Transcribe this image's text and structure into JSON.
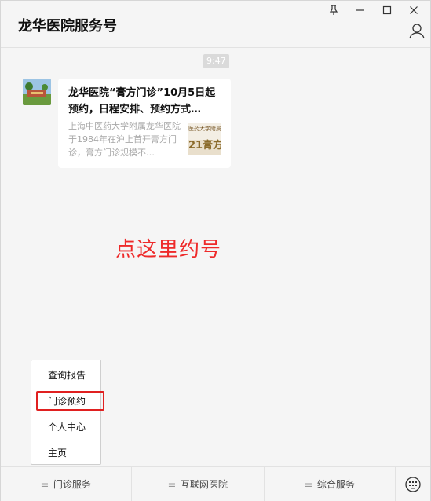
{
  "window": {
    "title": "龙华医院服务号"
  },
  "controls": {
    "pin_icon": "pin-icon",
    "minimize_icon": "minimize-icon",
    "maximize_icon": "maximize-icon",
    "close_icon": "close-icon",
    "user_icon": "user-icon"
  },
  "chat": {
    "timestamp": "9:47",
    "message": {
      "title": "龙华医院“膏方门诊”10月5日起预约，日程安排、预约方式…",
      "description": "上海中医药大学附属龙华医院于1984年在沪上首开膏方门诊，膏方门诊规模不…",
      "thumb_text_top": "医药大学附属",
      "thumb_text_bottom": "21膏方"
    },
    "annotation": "点这里约号"
  },
  "menu": {
    "items": [
      {
        "label": "查询报告"
      },
      {
        "label": "门诊预约"
      },
      {
        "label": "个人中心"
      },
      {
        "label": "主页"
      }
    ]
  },
  "bottom_tabs": [
    {
      "label": "门诊服务"
    },
    {
      "label": "互联网医院"
    },
    {
      "label": "综合服务"
    }
  ],
  "colors": {
    "accent_red": "#e02020",
    "annotation_red": "#ee2a2a",
    "background": "#f5f5f5"
  }
}
